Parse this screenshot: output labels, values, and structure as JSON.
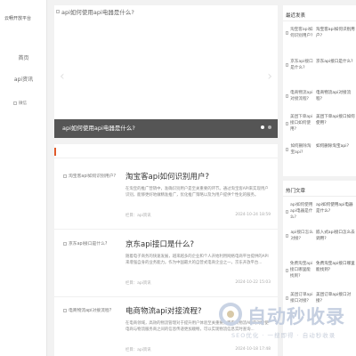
{
  "site": {
    "name": "云畅开放平台",
    "nav": [
      "首页",
      "api资讯"
    ],
    "wechat_alt": "微信"
  },
  "slider": {
    "image_alt": "api如何使用api电器是什么?",
    "caption": "api如何使用api电器是什么?",
    "prev_arrow": "‹",
    "next_arrow": "›",
    "slide_count": 2,
    "active_slide": 1
  },
  "articles": [
    {
      "thumb_alt": "淘宝客api如何识别用户?",
      "title": "淘宝客api如何识别用户?",
      "excerpt": "在淘宝的推广营销中，准确识别用户是至关重要的环节。通过淘宝客API来实现用户识别，能够更好地做精准推广，优化推广策略以及为用户提供个性化的服务。",
      "category": "栏目：api资讯",
      "date": "2024-10-24 18:59"
    },
    {
      "thumb_alt": "京东api接口是什么?",
      "title": "京东api接口是什么?",
      "excerpt": "随着电子商务的快速发展，越来越多的企业和个人开始利用网络电商平台提供的API来增强自身的业务能力。作为中国最大的自营式电商企业之一，京东开放平台...",
      "category": "栏目：api资讯",
      "date": "2024-10-22 15:03"
    },
    {
      "thumb_alt": "电商物流api对接流程?",
      "title": "电商物流api对接流程?",
      "excerpt": "在电商领域，高效的物流管理对于提升用户体验至关重要，而电商物流API的对接使电商与物流服务商之间的信息传递更加顺畅，可以实现物流信息实时查询...",
      "category": "栏目：api资讯",
      "date": "2024-10-18 17:48"
    }
  ],
  "sidebar": {
    "recent_title": "最近发表",
    "recent": [
      {
        "thumb_alt": "淘宝客api如何识别用户?",
        "text": "淘宝客api如何识别用户?"
      },
      {
        "thumb_alt": "京东api接口是什么?",
        "text": "京东api接口是什么?"
      },
      {
        "thumb_alt": "电商物流api对接流程?",
        "text": "电商物流api对接流程?"
      },
      {
        "thumb_alt": "美团下单api接口如何使用?",
        "text": "美团下单api接口如何使用?"
      },
      {
        "thumb_alt": "如何删除淘宝api?",
        "text": "如何删除淘宝api?"
      }
    ],
    "hot_title": "热门文章",
    "hot": [
      {
        "thumb_alt": "api如何使用api电器是什么?",
        "text": "api如何使用api电器是什么?"
      },
      {
        "thumb_alt": "api接口怎么对接?",
        "text": "嵌入式api接口怎么去调用?"
      },
      {
        "thumb_alt": "免费淘宝api接口哪里能找到?",
        "text": "免费淘宝api接口哪里能找到?"
      },
      {
        "thumb_alt": "美团订单api接口对接?",
        "text": "美团订单api接口对接?"
      }
    ]
  },
  "watermark": {
    "title": "自动秒收录",
    "subtitle": "SEO优化 · 一搜即得 · 自动秒收录"
  }
}
